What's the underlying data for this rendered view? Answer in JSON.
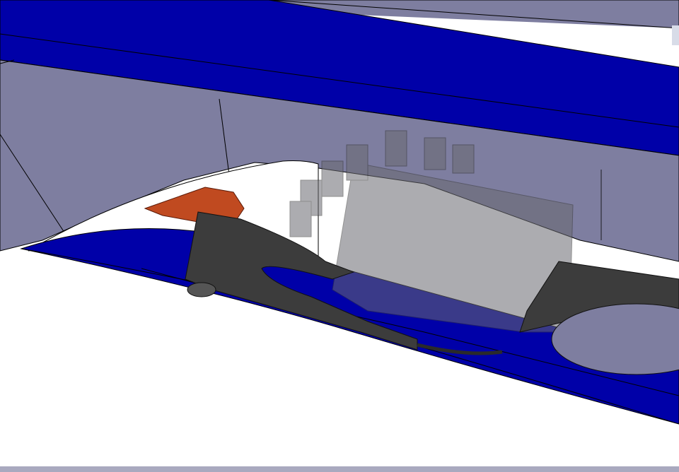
{
  "scene": {
    "description_name": "cad-3d-viewport",
    "colors": {
      "background": "#ffffff",
      "body_gray": "#7e7ea0",
      "rail_blue": "#0000a8",
      "rail_blue_dark": "#000080",
      "clip_dark": "#3c3c3c",
      "clip_mid": "#2a2a2a",
      "orange_part": "#c04a20",
      "ghost_part": "#6a6a70",
      "bottom_bar": "#a9a9bf"
    }
  }
}
